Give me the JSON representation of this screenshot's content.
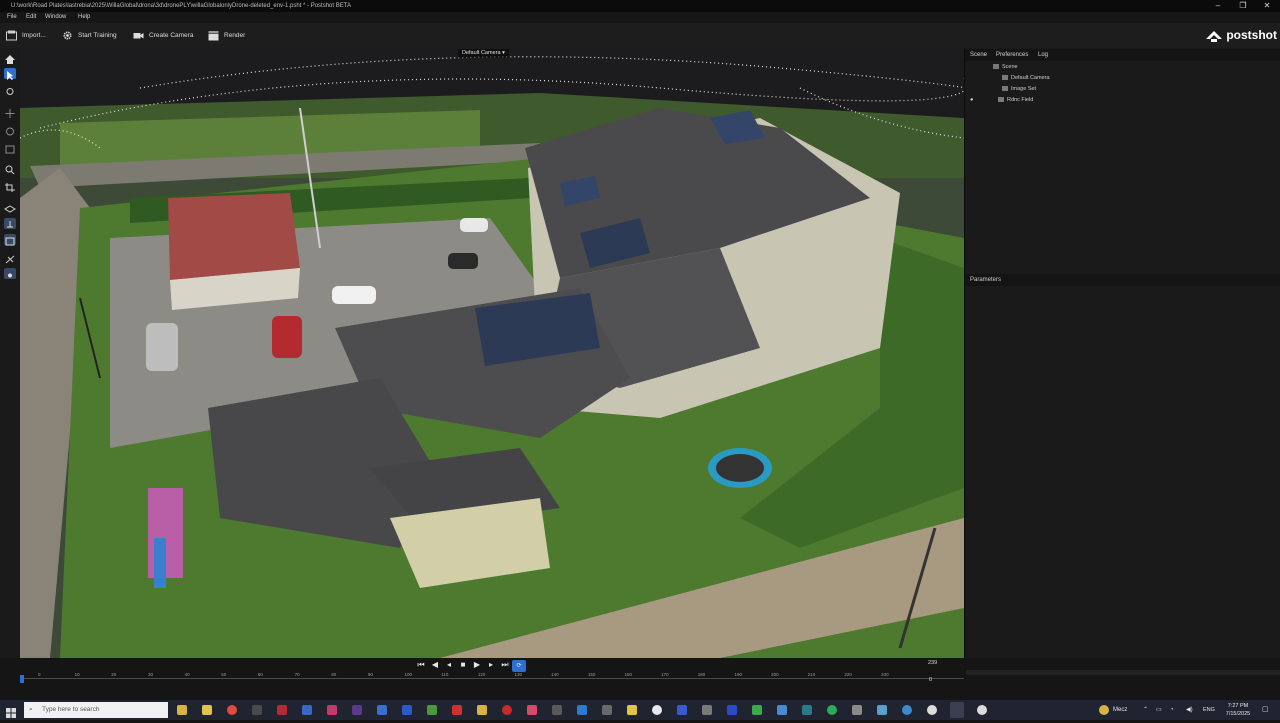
{
  "window": {
    "title": "U:\\work\\Road Plates\\lastrebia\\2025\\WillaGlobal\\drona\\3d\\dronePLY\\willaGlobalonlyDrone-deleted_env-1.psht * - Postshot BETA",
    "controls": [
      "–",
      "❐",
      "✕"
    ]
  },
  "menu": [
    "File",
    "Edit",
    "Window",
    "Help"
  ],
  "toolbar": {
    "import": "Import...",
    "start_training": "Start Training",
    "create_camera": "Create Camera",
    "render": "Render",
    "logo": "postshot"
  },
  "viewport": {
    "camera_label": "Default Camera"
  },
  "panel": {
    "tabs": [
      "Scene",
      "Preferences",
      "Log"
    ],
    "tree": [
      {
        "label": "Scene"
      },
      {
        "label": "Default Camera"
      },
      {
        "label": "Image Set"
      },
      {
        "label": "Rdnc Field"
      }
    ],
    "parameters": "Parameters"
  },
  "timeline": {
    "end_frame": "239",
    "current_frame": "0",
    "ticks": [
      "0",
      "10",
      "20",
      "30",
      "40",
      "50",
      "60",
      "70",
      "80",
      "90",
      "100",
      "110",
      "120",
      "130",
      "140",
      "150",
      "160",
      "170",
      "180",
      "190",
      "200",
      "210",
      "220",
      "230"
    ]
  },
  "taskbar": {
    "search_placeholder": "Type here to search",
    "weather": "Mecz",
    "lang": "ENG",
    "time": "7:27 PM",
    "date": "7/15/2025"
  },
  "colors": {
    "accent": "#2f6fd0",
    "panel": "#1a1a1a",
    "toolbar": "#1d1d1d"
  }
}
